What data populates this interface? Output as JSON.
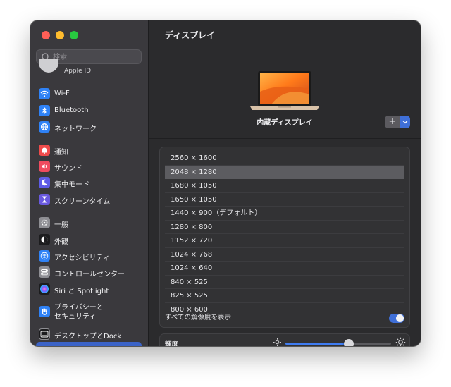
{
  "search": {
    "placeholder": "検索"
  },
  "sidebar": {
    "apple_id": "Apple ID",
    "items": [
      {
        "label": "Wi-Fi",
        "icon": "wifi-icon",
        "color": "#2f82f6"
      },
      {
        "label": "Bluetooth",
        "icon": "bluetooth-icon",
        "color": "#2f82f6"
      },
      {
        "label": "ネットワーク",
        "icon": "globe-icon",
        "color": "#2f82f6"
      },
      {
        "label": "通知",
        "icon": "bell-icon",
        "color": "#ef4b4b"
      },
      {
        "label": "サウンド",
        "icon": "speaker-icon",
        "color": "#ef4b5f"
      },
      {
        "label": "集中モード",
        "icon": "moon-icon",
        "color": "#5e5ce6"
      },
      {
        "label": "スクリーンタイム",
        "icon": "hourglass-icon",
        "color": "#6a5ae0"
      },
      {
        "label": "一般",
        "icon": "gear-icon",
        "color": "#8e8e93"
      },
      {
        "label": "外観",
        "icon": "appearance-icon",
        "color": "#1c1c1e"
      },
      {
        "label": "アクセシビリティ",
        "icon": "accessibility-icon",
        "color": "#2f82f6"
      },
      {
        "label": "コントロールセンター",
        "icon": "control-center-icon",
        "color": "#8e8e93"
      },
      {
        "label": "Siri と Spotlight",
        "icon": "siri-icon",
        "color": "#b14ad9"
      },
      {
        "label": "プライバシーと\nセキュリティ",
        "icon": "hand-icon",
        "color": "#2f82f6"
      },
      {
        "label": "デスクトップとDock",
        "icon": "dock-icon",
        "color": "#1c1c1e"
      }
    ]
  },
  "main": {
    "title": "ディスプレイ",
    "display_name": "内蔵ディスプレイ",
    "add_button": "+",
    "resolutions": [
      "2560 × 1600",
      "2048 × 1280",
      "1680 × 1050",
      "1650 × 1050",
      "1440 × 900（デフォルト）",
      "1280 × 800",
      "1152 × 720",
      "1024 × 768",
      "1024 × 640",
      "840 × 525",
      "825 × 525",
      "800 × 600"
    ],
    "selected_index": 1,
    "show_all_label": "すべての解像度を表示",
    "show_all_on": true,
    "brightness_label": "輝度",
    "brightness_level": 0.6,
    "accent_color": "#3f6fd8"
  }
}
